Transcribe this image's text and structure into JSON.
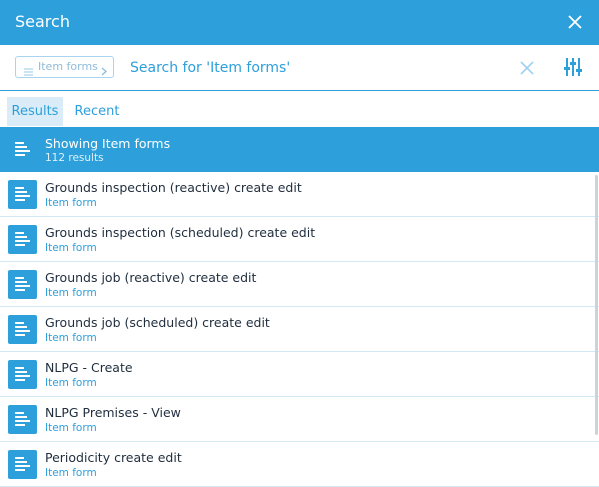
{
  "header": {
    "title": "Search",
    "close_icon": "close-icon"
  },
  "search": {
    "chip_label": "Item forms",
    "placeholder": "Search for 'Item forms'",
    "clear_icon": "clear-icon",
    "filter_icon": "filter-sliders-icon"
  },
  "tabs": [
    {
      "label": "Results",
      "active": true
    },
    {
      "label": "Recent",
      "active": false
    }
  ],
  "summary": {
    "title": "Showing Item forms",
    "count": "112 results"
  },
  "results": [
    {
      "title": "Grounds inspection (reactive) create edit",
      "type": "Item form"
    },
    {
      "title": "Grounds inspection (scheduled) create edit",
      "type": "Item form"
    },
    {
      "title": "Grounds job (reactive) create edit",
      "type": "Item form"
    },
    {
      "title": "Grounds job (scheduled) create edit",
      "type": "Item form"
    },
    {
      "title": "NLPG - Create",
      "type": "Item form"
    },
    {
      "title": "NLPG Premises - View",
      "type": "Item form"
    },
    {
      "title": "Periodicity create edit",
      "type": "Item form"
    }
  ],
  "colors": {
    "accent": "#2d9fdb",
    "tab_active_bg": "#d9ecf7",
    "text": "#1f2d3d"
  }
}
